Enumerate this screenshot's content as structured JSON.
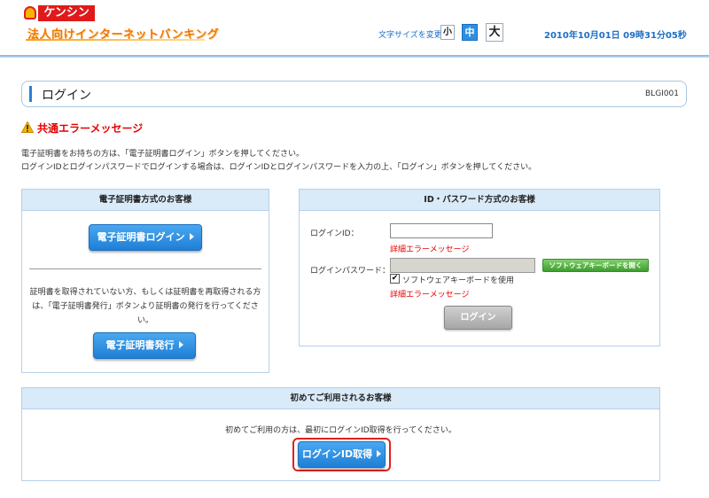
{
  "header": {
    "logo_text": "ケンシン",
    "service_name": "法人向けインターネットバンキング",
    "fontsize_label": "文字サイズを変更",
    "fontsize_small": "小",
    "fontsize_medium": "中",
    "fontsize_large": "大",
    "datetime": "2010年10月01日 09時31分05秒"
  },
  "title_bar": {
    "title": "ログイン",
    "screen_id": "BLGI001"
  },
  "error": {
    "title": "共通エラーメッセージ",
    "icon": "warning-icon"
  },
  "instructions": [
    "電子証明書をお持ちの方は、「電子証明書ログイン」ボタンを押してください。",
    "ログインIDとログインパスワードでログインする場合は、ログインIDとログインパスワードを入力の上、「ログイン」ボタンを押してください。"
  ],
  "cert_panel": {
    "heading": "電子証明書方式のお客様",
    "login_button": "電子証明書ログイン",
    "note": "証明書を取得されていない方、もしくは証明書を再取得される方は、「電子証明書発行」ボタンより証明書の発行を行ってください。",
    "issue_button": "電子証明書発行"
  },
  "idpw_panel": {
    "heading": "ID・パスワード方式のお客様",
    "login_id_label": "ログインID：",
    "login_id_value": "",
    "login_id_error": "詳細エラーメッセージ",
    "login_pw_label": "ログインパスワード：",
    "login_pw_value": "",
    "software_keyboard_button": "ソフトウェアキーボードを開く",
    "software_keyboard_check": "ソフトウェアキーボードを使用",
    "software_keyboard_checked": true,
    "login_pw_error": "詳細エラーメッセージ",
    "login_button": "ログイン"
  },
  "first_panel": {
    "heading": "初めてご利用されるお客様",
    "description": "初めてご利用の方は、最初にログインID取得を行ってください。",
    "button": "ログインID取得"
  },
  "colors": {
    "accent_blue": "#1e7fd6",
    "error_red": "#e60000",
    "brand_orange": "#f07800",
    "panel_head": "#d9eaf8"
  }
}
